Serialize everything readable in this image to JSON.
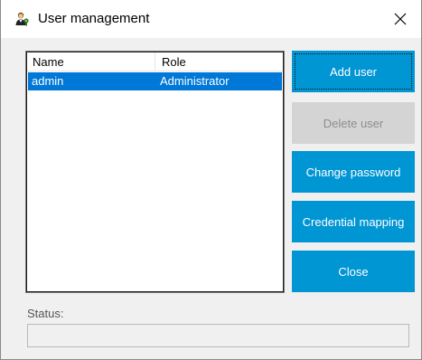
{
  "window": {
    "title": "User management",
    "app_icon": "user-management-icon",
    "close_icon": "close-icon"
  },
  "user_list": {
    "columns": [
      "Name",
      "Role"
    ],
    "rows": [
      {
        "name": "admin",
        "role": "Administrator",
        "selected": true
      }
    ]
  },
  "buttons": {
    "add_user": "Add user",
    "delete_user": "Delete user",
    "change_password": "Change password",
    "credential_mapping": "Credential mapping",
    "close": "Close"
  },
  "status": {
    "label": "Status:",
    "value": ""
  },
  "colors": {
    "button": "#0095d3",
    "button_disabled": "#d4d4d4",
    "selection": "#0078d7"
  }
}
